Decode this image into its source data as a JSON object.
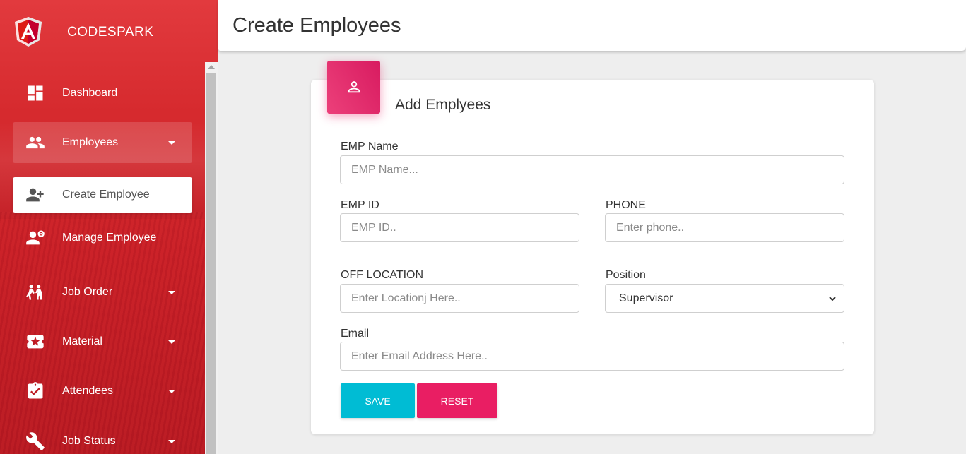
{
  "brand": {
    "name": "CODESPARK",
    "logo_icon": "angular-logo-icon"
  },
  "sidebar": {
    "items": [
      {
        "label": "Dashboard",
        "icon": "dashboard-icon",
        "has_caret": false
      },
      {
        "label": "Employees",
        "icon": "people-icon",
        "has_caret": true
      },
      {
        "label": "Create Employee",
        "icon": "person-add-icon",
        "has_caret": false
      },
      {
        "label": "Manage Employee",
        "icon": "manage-user-icon",
        "has_caret": false
      },
      {
        "label": "Job Order",
        "icon": "worker-icon",
        "has_caret": true
      },
      {
        "label": "Material",
        "icon": "ticket-star-icon",
        "has_caret": true
      },
      {
        "label": "Attendees",
        "icon": "clipboard-check-icon",
        "has_caret": true
      },
      {
        "label": "Job Status",
        "icon": "wrench-icon",
        "has_caret": true
      }
    ]
  },
  "header": {
    "title": "Create Employees"
  },
  "form": {
    "title": "Add Emplyees",
    "icon": "person-icon",
    "emp_name": {
      "label": "EMP Name",
      "placeholder": "EMP Name..."
    },
    "emp_id": {
      "label": "EMP ID",
      "placeholder": "EMP ID.."
    },
    "phone": {
      "label": "PHONE",
      "placeholder": "Enter phone.."
    },
    "location": {
      "label": "OFF LOCATION",
      "placeholder": "Enter Locationj Here.."
    },
    "position": {
      "label": "Position",
      "value": "Supervisor"
    },
    "email": {
      "label": "Email",
      "placeholder": "Enter Email Address Here.."
    },
    "save_label": "SAVE",
    "reset_label": "RESET"
  },
  "colors": {
    "sidebar": "#d62a2e",
    "save": "#00bcd4",
    "reset": "#e91e63",
    "card_icon": "#e91e63"
  }
}
